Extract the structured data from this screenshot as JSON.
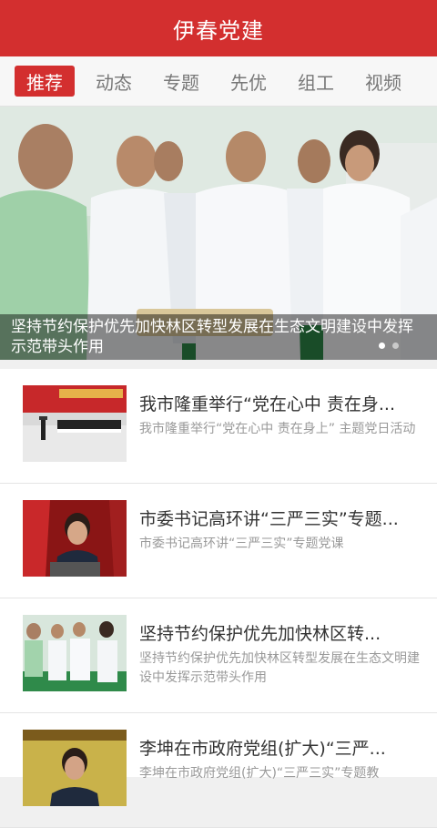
{
  "app": {
    "title": "伊春党建"
  },
  "tabs": [
    {
      "label": "推荐",
      "active": true
    },
    {
      "label": "动态",
      "active": false
    },
    {
      "label": "专题",
      "active": false
    },
    {
      "label": "先优",
      "active": false
    },
    {
      "label": "组工",
      "active": false
    },
    {
      "label": "视频",
      "active": false
    }
  ],
  "banner": {
    "caption": "坚持节约保护优先加快林区转型发展在生态文明建设中发挥示范带头作用",
    "slide_count": 2,
    "active_slide": 1
  },
  "news": [
    {
      "title": "我市隆重举行“党在心中 责在身...",
      "desc": "我市隆重举行“党在心中 责在身上” 主题党日活动"
    },
    {
      "title": "市委书记高环讲“三严三实”专题...",
      "desc": "市委书记高环讲“三严三实”专题党课"
    },
    {
      "title": "坚持节约保护优先加快林区转...",
      "desc": "坚持节约保护优先加快林区转型发展在生态文明建设中发挥示范带头作用"
    },
    {
      "title": "李坤在市政府党组(扩大)“三严...",
      "desc": "李坤在市政府党组(扩大)“三严三实”专题教"
    }
  ],
  "colors": {
    "primary": "#d32f2f",
    "tab_text": "#777777",
    "desc_text": "#999999"
  }
}
